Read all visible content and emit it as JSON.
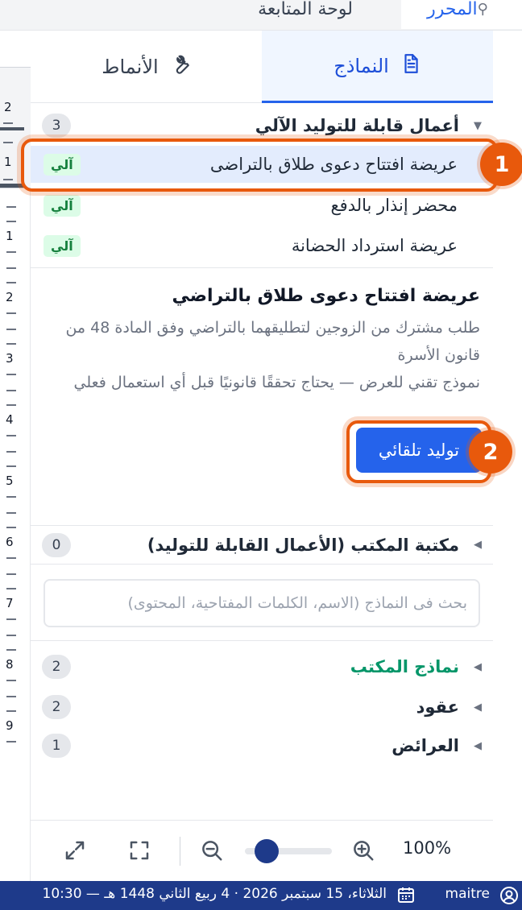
{
  "top_tabs": {
    "editor": "المحرر",
    "dashboard": "لوحة المتابعة"
  },
  "panel_tabs": {
    "templates": "النماذج",
    "styles": "الأنماط"
  },
  "auto_group": {
    "title": "أعمال قابلة للتوليد الآلي",
    "count": "3",
    "items": [
      {
        "name": "عريضة افتتاح دعوى طلاق بالتراضى",
        "badge": "آلي"
      },
      {
        "name": "محضر إنذار بالدفع",
        "badge": "آلي"
      },
      {
        "name": "عريضة استرداد الحضانة",
        "badge": "آلي"
      }
    ]
  },
  "detail": {
    "title": "عريضة افتتاح دعوى طلاق بالتراضي",
    "description": "طلب مشترك من الزوجين لتطليقهما بالتراضي وفق المادة 48 من قانون الأسرة",
    "note": "نموذج تقني للعرض — يحتاج تحققًا قانونيًا قبل أي استعمال فعلي",
    "generate_button": "توليد تلقائي"
  },
  "library": {
    "title": "مكتبة المكتب (الأعمال القابلة للتوليد)",
    "count": "0"
  },
  "search": {
    "placeholder": "بحث فى النماذج (الاسم، الكلمات المفتاحية، المحتوى)"
  },
  "categories": [
    {
      "title": "نماذج المكتب",
      "count": "2",
      "color": "#059669"
    },
    {
      "title": "عقود",
      "count": "2",
      "color": "#1f2937"
    },
    {
      "title": "العرائض",
      "count": "1",
      "color": "#1f2937"
    }
  ],
  "zoom": {
    "value": "100%",
    "level_percent": 100
  },
  "ruler": {
    "labels": [
      "2",
      "1",
      "1",
      "2",
      "3",
      "4",
      "5",
      "6",
      "7",
      "8",
      "9"
    ]
  },
  "statusbar": {
    "user": "maitre",
    "date": "الثلاثاء، 15 سبتمبر 2026 · 4 ربيع الثاني 1448 هـ — 10:30"
  },
  "callouts": {
    "first": "1",
    "second": "2"
  },
  "colors": {
    "accent": "#2563eb",
    "callout": "#e8590c",
    "statusbar": "#1e3a8a",
    "badge_bg": "#dcfce7"
  }
}
